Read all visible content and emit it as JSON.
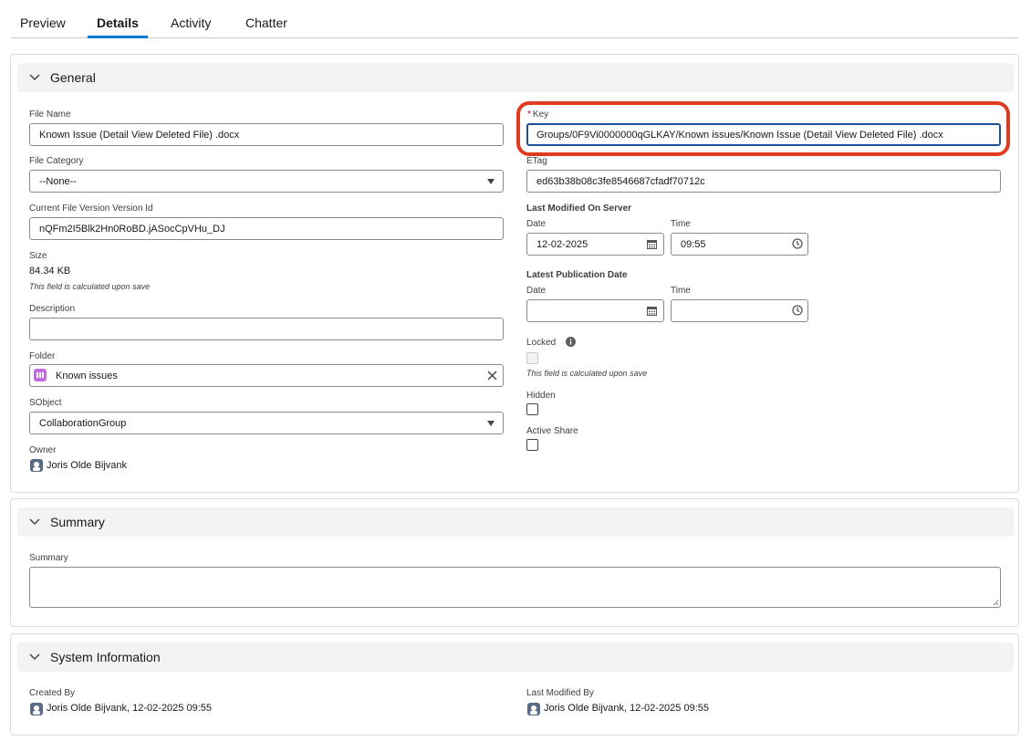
{
  "tabs": [
    {
      "label": "Preview"
    },
    {
      "label": "Details"
    },
    {
      "label": "Activity"
    },
    {
      "label": "Chatter"
    }
  ],
  "general": {
    "title": "General",
    "file_name": {
      "label": "File Name",
      "value": "Known Issue (Detail View Deleted File) .docx"
    },
    "file_category": {
      "label": "File Category",
      "value": "--None--"
    },
    "version_id": {
      "label": "Current File Version Version Id",
      "value": "nQFm2I5Blk2Hn0RoBD.jASocCpVHu_DJ"
    },
    "size": {
      "label": "Size",
      "value": "84.34 KB",
      "hint": "This field is calculated upon save"
    },
    "description": {
      "label": "Description",
      "value": ""
    },
    "folder": {
      "label": "Folder",
      "value": "Known issues"
    },
    "sobject": {
      "label": "SObject",
      "value": "CollaborationGroup"
    },
    "owner": {
      "label": "Owner",
      "value": "Joris Olde Bijvank"
    },
    "key": {
      "required_marker": "*",
      "label": "Key",
      "value": "Groups/0F9Vi0000000qGLKAY/Known issues/Known Issue (Detail View Deleted File) .docx"
    },
    "etag": {
      "label": "ETag",
      "value": "ed63b38b08c3fe8546687cfadf70712c"
    },
    "last_modified_server": {
      "label": "Last Modified On Server",
      "date_label": "Date",
      "date_value": "12-02-2025",
      "time_label": "Time",
      "time_value": "09:55"
    },
    "latest_publication": {
      "label": "Latest Publication Date",
      "date_label": "Date",
      "date_value": "",
      "time_label": "Time",
      "time_value": ""
    },
    "locked": {
      "label": "Locked",
      "hint": "This field is calculated upon save",
      "checked": false
    },
    "hidden": {
      "label": "Hidden",
      "checked": false
    },
    "active_share": {
      "label": "Active Share",
      "checked": false
    }
  },
  "summary": {
    "title": "Summary",
    "field_label": "Summary",
    "value": ""
  },
  "system": {
    "title": "System Information",
    "created_by_label": "Created By",
    "created_by_value": "Joris Olde Bijvank, 12-02-2025 09:55",
    "modified_by_label": "Last Modified By",
    "modified_by_value": "Joris Olde Bijvank, 12-02-2025 09:55"
  },
  "colors": {
    "highlight": "#e13a1e",
    "focus_border": "#1b5297",
    "active_tab": "#0176d3",
    "folder_icon": "#c56ae0"
  }
}
